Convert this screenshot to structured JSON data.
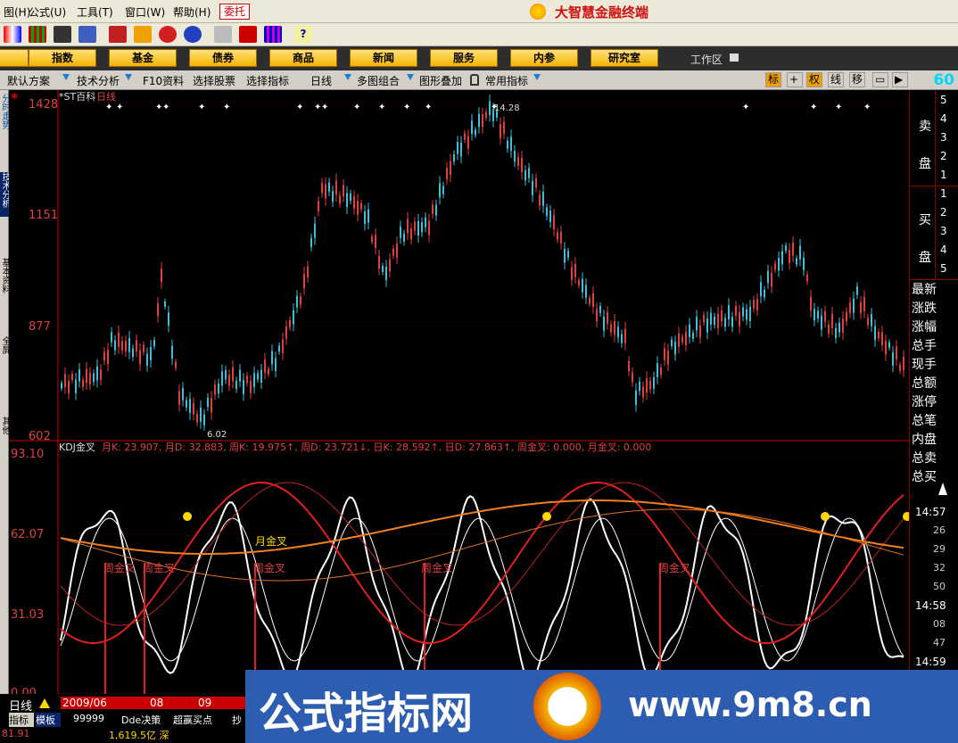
{
  "menubar": {
    "items": [
      "帮助(H)",
      "窗口(W)",
      "工具(T)",
      "公式(U)",
      "图(H)"
    ],
    "entrust": "委托",
    "brand": "大智慧金融终端"
  },
  "navbar": {
    "items": [
      "指数",
      "基金",
      "债券",
      "商品",
      "新闻",
      "服务",
      "内参",
      "研究室"
    ],
    "workarea": "工作区"
  },
  "funcbar": {
    "items": [
      "默认方案",
      "技术分析",
      "F10资料",
      "选择股票",
      "选择指标",
      "日线",
      "多图组合",
      "图形叠加",
      "常用指标"
    ],
    "right_buttons": [
      "标",
      "权",
      "线",
      "移"
    ],
    "right_number": "60"
  },
  "left_tabs": [
    "分时走势",
    "技术分析",
    "基本资料",
    "全屏",
    "其他"
  ],
  "price_chart": {
    "stock": "*ST百科",
    "period": "日线",
    "y_labels": [
      "1428",
      "1151",
      "877",
      "602"
    ],
    "high_label": "14.28",
    "low_label": "6.02"
  },
  "kdj": {
    "name": "KDJ金叉",
    "stats": "月K: 23.907, 月D: 32.883, 周K: 19.975↑, 周D: 23.721↓, 日K: 28.592↑, 日D: 27.863↑, 周金叉: 0.000, 月金叉: 0.000",
    "y_labels": [
      "93.10",
      "62.07",
      "31.03",
      "0.00"
    ],
    "cross_labels": [
      "周金叉",
      "周金叉",
      "周金叉",
      "周金叉",
      "周金叉",
      "月金叉"
    ]
  },
  "right_panel": {
    "sell": "卖盘",
    "buy": "买盘",
    "sell_levels": [
      "5",
      "4",
      "3",
      "2",
      "1"
    ],
    "buy_levels": [
      "1",
      "2",
      "3",
      "4",
      "5"
    ],
    "fields": [
      "最新",
      "涨跌",
      "涨幅",
      "总手",
      "现手",
      "总额",
      "涨停",
      "总笔",
      "内盘",
      "总卖",
      "总买"
    ],
    "times": [
      "14:57",
      "26",
      "29",
      "32",
      "50",
      "14:58",
      "08",
      "47",
      "14:59"
    ]
  },
  "bottom": {
    "period": "日线",
    "dates": [
      "2009/06",
      "08",
      "09"
    ],
    "tabs": [
      "指标",
      "模板",
      "99999",
      "Dde决策",
      "超赢买点",
      "抄"
    ],
    "price": "81.91",
    "volume": "1,619.5亿 深"
  },
  "watermark": {
    "text1": "公式指标网",
    "text2": "www.9m8.cn"
  },
  "colors": {
    "up": "#e04040",
    "down": "#40c0d8",
    "gold": "#ffd800",
    "axis": "#c00000",
    "white": "#ffffff",
    "nav": "#f4b400"
  }
}
